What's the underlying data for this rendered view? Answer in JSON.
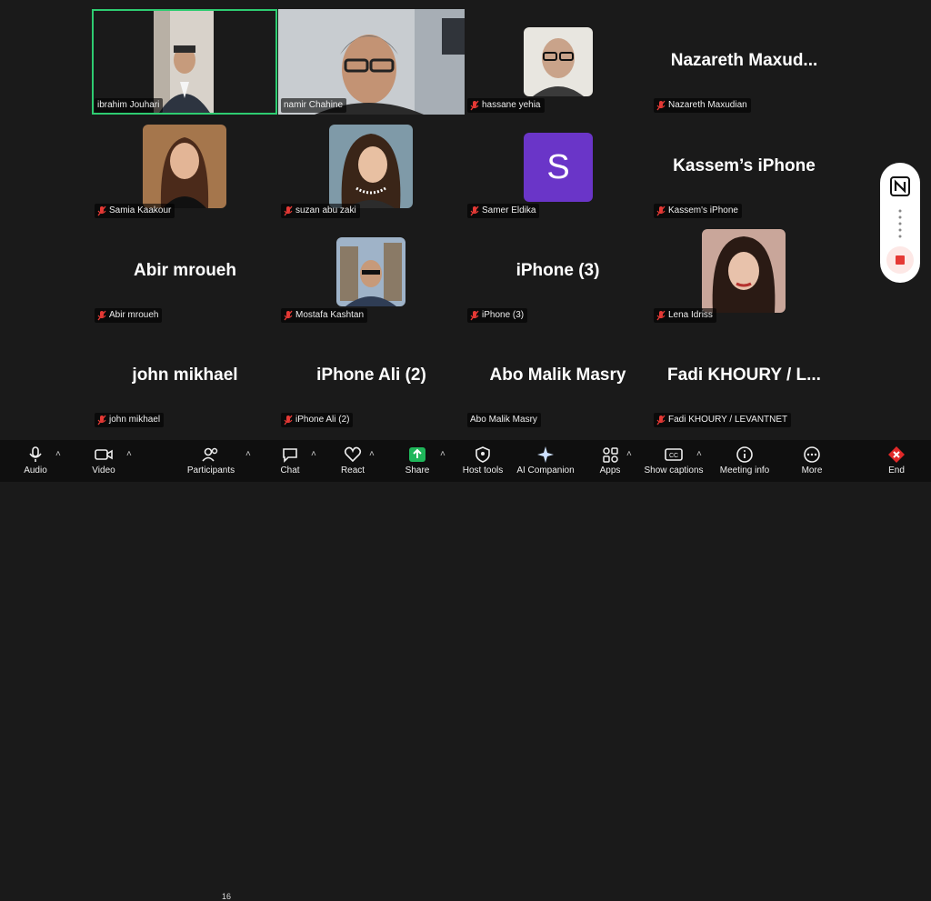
{
  "participants": [
    {
      "label": "ibrahim Jouhari",
      "muted": false,
      "video": true
    },
    {
      "label": "namir Chahine",
      "muted": false,
      "video": true
    },
    {
      "label": "hassane yehia",
      "muted": true,
      "photo": true
    },
    {
      "label": "Nazareth Maxudian",
      "display": "Nazareth  Maxud...",
      "muted": true
    },
    {
      "label": "Samia Kaakour",
      "muted": true,
      "photo": true
    },
    {
      "label": "suzan abu zaki",
      "muted": true,
      "photo": true
    },
    {
      "label": "Samer Eldika",
      "initial": "S",
      "muted": true
    },
    {
      "label": "Kassem's iPhone",
      "display": "Kassem’s iPhone",
      "muted": true
    },
    {
      "label": "Abir mroueh",
      "display": "Abir mroueh",
      "muted": true
    },
    {
      "label": "Mostafa Kashtan",
      "muted": true,
      "photo": true
    },
    {
      "label": "iPhone (3)",
      "display": "iPhone (3)",
      "muted": true
    },
    {
      "label": "Lena Idriss",
      "muted": true,
      "photo": true
    },
    {
      "label": "john mikhael",
      "display": "john mikhael",
      "muted": true
    },
    {
      "label": "iPhone Ali (2)",
      "display": "iPhone Ali (2)",
      "muted": true
    },
    {
      "label": "Abo Malik Masry",
      "display": "Abo Malik Masry",
      "muted": false
    },
    {
      "label": "Fadi KHOURY / LEVANTNET",
      "display": "Fadi KHOURY / L...",
      "muted": true
    }
  ],
  "toolbar": {
    "audio": "Audio",
    "video": "Video",
    "participants": "Participants",
    "participants_count": "16",
    "chat": "Chat",
    "react": "React",
    "share": "Share",
    "host_tools": "Host tools",
    "ai_companion": "AI Companion",
    "apps": "Apps",
    "show_captions": "Show captions",
    "meeting_info": "Meeting info",
    "more": "More",
    "end": "End"
  },
  "colors": {
    "active_speaker": "#2ecc71",
    "share": "#1fb65a",
    "end": "#e02828",
    "avatar_purple": "#6a35c8"
  }
}
